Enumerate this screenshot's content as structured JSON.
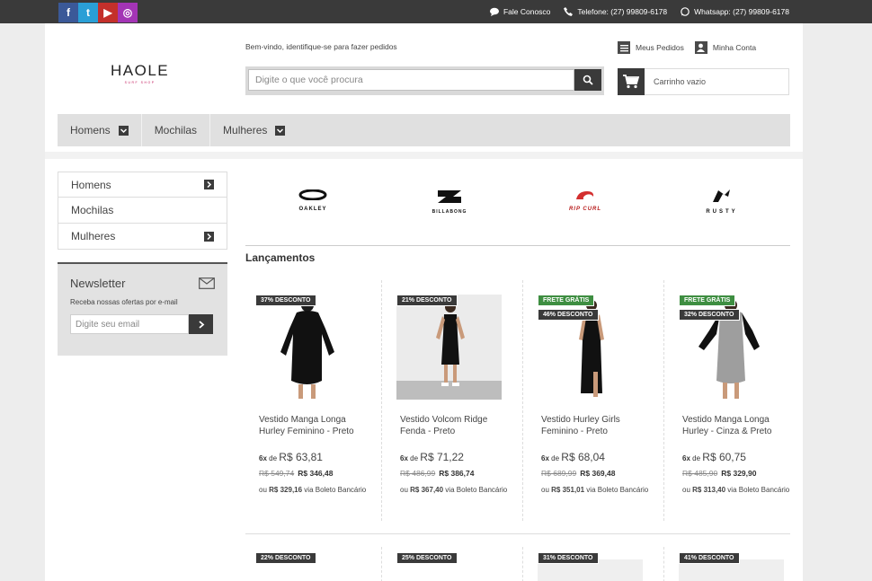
{
  "topbar": {
    "contact": "Fale Conosco",
    "phone": "Telefone: (27) 99809-6178",
    "whatsapp": "Whatsapp: (27) 99809-6178",
    "social": [
      "f",
      "t",
      "▶",
      "◎"
    ]
  },
  "logo": {
    "main": "HAOLE",
    "sub": "SURF SHOP"
  },
  "header": {
    "welcome": "Bem-vindo, identifique-se para fazer pedidos",
    "search_placeholder": "Digite o que você procura",
    "my_orders": "Meus Pedidos",
    "my_account": "Minha Conta",
    "cart": "Carrinho vazio"
  },
  "nav": {
    "items": [
      "Homens",
      "Mochilas",
      "Mulheres"
    ]
  },
  "sidebar": {
    "categories": [
      "Homens",
      "Mochilas",
      "Mulheres"
    ],
    "newsletter": {
      "title": "Newsletter",
      "desc": "Receba nossas ofertas por e-mail",
      "placeholder": "Digite seu email"
    }
  },
  "brands": [
    "OAKLEY",
    "BILLABONG",
    "RIP CURL",
    "RUSTY"
  ],
  "section_title": "Lançamentos",
  "products": [
    {
      "badges": [
        "37% DESCONTO"
      ],
      "badge_colors": [
        "#3a3a3a"
      ],
      "name": "Vestido Manga Longa Hurley Feminino - Preto",
      "inst_qty": "6x",
      "inst_de": "de",
      "inst_val": "R$ 63,81",
      "old": "R$ 549,74",
      "price": "R$ 346,48",
      "ou": "ou",
      "boleto_val": "R$ 329,16",
      "boleto_txt": "via Boleto Bancário"
    },
    {
      "badges": [
        "21% DESCONTO"
      ],
      "badge_colors": [
        "#3a3a3a"
      ],
      "name": "Vestido Volcom Ridge Fenda - Preto",
      "inst_qty": "6x",
      "inst_de": "de",
      "inst_val": "R$ 71,22",
      "old": "R$ 486,99",
      "price": "R$ 386,74",
      "ou": "ou",
      "boleto_val": "R$ 367,40",
      "boleto_txt": "via Boleto Bancário"
    },
    {
      "badges": [
        "FRETE GRÁTIS",
        "46% DESCONTO"
      ],
      "badge_colors": [
        "#3e8e41",
        "#3a3a3a"
      ],
      "name": "Vestido Hurley Girls Feminino - Preto",
      "inst_qty": "6x",
      "inst_de": "de",
      "inst_val": "R$ 68,04",
      "old": "R$ 689,99",
      "price": "R$ 369,48",
      "ou": "ou",
      "boleto_val": "R$ 351,01",
      "boleto_txt": "via Boleto Bancário"
    },
    {
      "badges": [
        "FRETE GRÁTIS",
        "32% DESCONTO"
      ],
      "badge_colors": [
        "#3e8e41",
        "#3a3a3a"
      ],
      "name": "Vestido Manga Longa Hurley - Cinza & Preto",
      "inst_qty": "6x",
      "inst_de": "de",
      "inst_val": "R$ 60,75",
      "old": "R$ 485,90",
      "price": "R$ 329,90",
      "ou": "ou",
      "boleto_val": "R$ 313,40",
      "boleto_txt": "via Boleto Bancário"
    }
  ],
  "products_row2": [
    {
      "badge": "22% DESCONTO"
    },
    {
      "badge": "25% DESCONTO"
    },
    {
      "badge": "31% DESCONTO"
    },
    {
      "badge": "41% DESCONTO"
    }
  ],
  "colors": {
    "dark": "#3a3a3a",
    "green": "#3e8e41",
    "accent_pink": "#c2185b"
  }
}
